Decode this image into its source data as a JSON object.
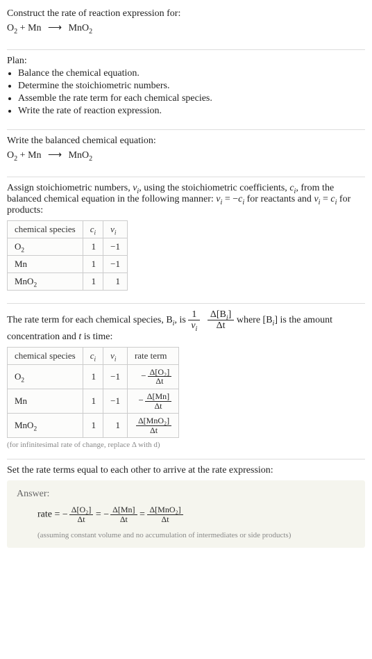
{
  "prompt": {
    "intro": "Construct the rate of reaction expression for:",
    "eq_lhs_o2": "O",
    "eq_lhs_o2_sub": "2",
    "eq_plus": " + ",
    "eq_lhs_mn": "Mn",
    "eq_arrow": "⟶",
    "eq_rhs_mno2": "MnO",
    "eq_rhs_mno2_sub": "2"
  },
  "plan": {
    "header": "Plan:",
    "items": [
      "Balance the chemical equation.",
      "Determine the stoichiometric numbers.",
      "Assemble the rate term for each chemical species.",
      "Write the rate of reaction expression."
    ]
  },
  "balanced": {
    "header": "Write the balanced chemical equation:"
  },
  "stoich_assign": {
    "text_a": "Assign stoichiometric numbers, ",
    "nu": "ν",
    "i": "i",
    "text_b": ", using the stoichiometric coefficients, ",
    "c": "c",
    "text_c": ", from the balanced chemical equation in the following manner: ",
    "eq1_lhs": "ν",
    "eq1_eq": " = −",
    "eq1_rhs": "c",
    "text_d": " for reactants and ",
    "eq2_lhs": "ν",
    "eq2_eq": " = ",
    "eq2_rhs": "c",
    "text_e": " for products:"
  },
  "table1": {
    "h1": "chemical species",
    "h2_c": "c",
    "h2_i": "i",
    "h3_nu": "ν",
    "h3_i": "i",
    "rows": [
      {
        "s_a": "O",
        "s_sub": "2",
        "c": "1",
        "nu": "−1"
      },
      {
        "s_a": "Mn",
        "s_sub": "",
        "c": "1",
        "nu": "−1"
      },
      {
        "s_a": "MnO",
        "s_sub": "2",
        "c": "1",
        "nu": "1"
      }
    ]
  },
  "rate_intro": {
    "text_a": "The rate term for each chemical species, B",
    "i": "i",
    "text_b": ", is ",
    "one": "1",
    "nu": "ν",
    "delta": "Δ[B",
    "delta_close": "]",
    "dt": "Δt",
    "text_c": " where [B",
    "text_d": "] is the amount concentration and ",
    "t": "t",
    "text_e": " is time:"
  },
  "table2": {
    "h1": "chemical species",
    "h2_c": "c",
    "h2_i": "i",
    "h3_nu": "ν",
    "h3_i": "i",
    "h4": "rate term",
    "rows": [
      {
        "s_a": "O",
        "s_sub": "2",
        "c": "1",
        "nu": "−1",
        "rt_sign": "−",
        "rt_num": "Δ[O₂]",
        "rt_den": "Δt"
      },
      {
        "s_a": "Mn",
        "s_sub": "",
        "c": "1",
        "nu": "−1",
        "rt_sign": "−",
        "rt_num": "Δ[Mn]",
        "rt_den": "Δt"
      },
      {
        "s_a": "MnO",
        "s_sub": "2",
        "c": "1",
        "nu": "1",
        "rt_sign": "",
        "rt_num": "Δ[MnO₂]",
        "rt_den": "Δt"
      }
    ],
    "footnote": "(for infinitesimal rate of change, replace Δ with d)"
  },
  "set_equal": "Set the rate terms equal to each other to arrive at the rate expression:",
  "answer": {
    "header": "Answer:",
    "rate_label": "rate = ",
    "t1_sign": "−",
    "t1_num": "Δ[O₂]",
    "t1_den": "Δt",
    "eq": " = ",
    "t2_sign": "−",
    "t2_num": "Δ[Mn]",
    "t2_den": "Δt",
    "t3_num": "Δ[MnO₂]",
    "t3_den": "Δt",
    "note": "(assuming constant volume and no accumulation of intermediates or side products)"
  }
}
